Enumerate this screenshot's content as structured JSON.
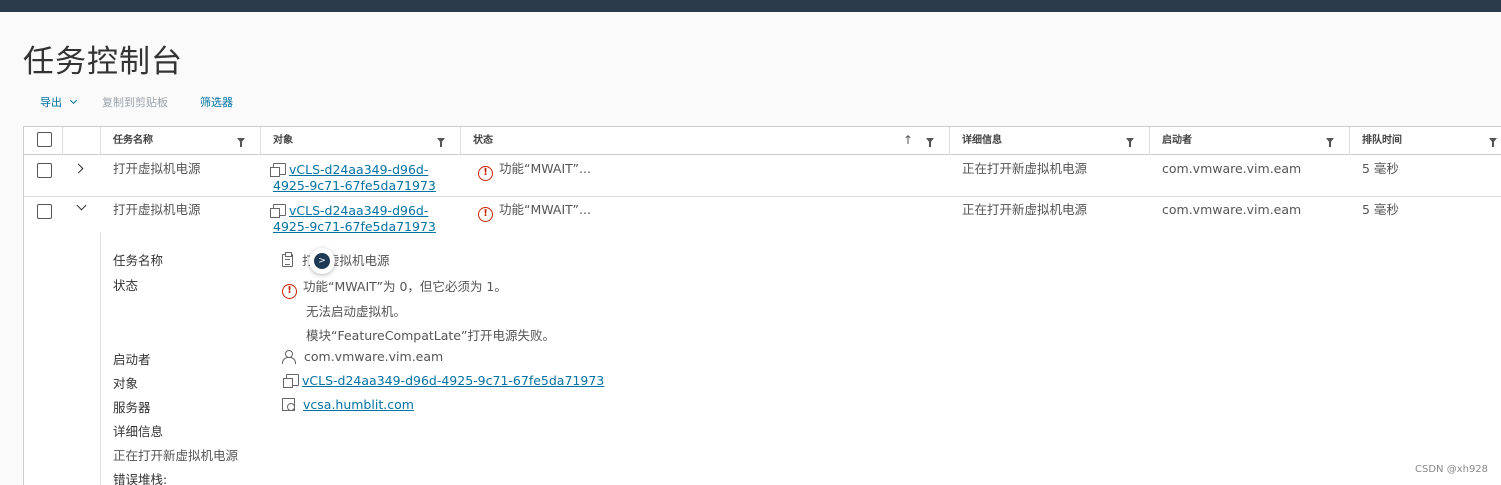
{
  "page": {
    "title": "任务控制台"
  },
  "toolbar": {
    "export_label": "导出",
    "copy_label": "复制到剪贴板",
    "filter_label": "筛选器"
  },
  "columns": {
    "task_name": "任务名称",
    "object": "对象",
    "status": "状态",
    "details": "详细信息",
    "initiator": "启动者",
    "queue_time": "排队时间"
  },
  "rows": [
    {
      "task_name": "打开虚拟机电源",
      "object_line1": "vCLS-d24aa349-d96d-",
      "object_line2": "4925-9c71-67fe5da71973",
      "status": "功能“MWAIT”...",
      "details": "正在打开新虚拟机电源",
      "initiator": "com.vmware.vim.eam",
      "queue_time": "5 毫秒"
    },
    {
      "task_name": "打开虚拟机电源",
      "object_line1": "vCLS-d24aa349-d96d-",
      "object_line2": "4925-9c71-67fe5da71973",
      "status": "功能“MWAIT”...",
      "details": "正在打开新虚拟机电源",
      "initiator": "com.vmware.vim.eam",
      "queue_time": "5 毫秒"
    }
  ],
  "detail": {
    "task_name_label": "任务名称",
    "task_name_value": "打开虚拟机电源",
    "status_label": "状态",
    "status_line1": "功能“MWAIT”为 0，但它必须为 1。",
    "status_line2": "无法启动虚拟机。",
    "status_line3": "模块“FeatureCompatLate”打开电源失败。",
    "initiator_label": "启动者",
    "initiator_value": "com.vmware.vim.eam",
    "object_label": "对象",
    "object_value": "vCLS-d24aa349-d96d-4925-9c71-67fe5da71973",
    "server_label": "服务器",
    "server_value": "vcsa.humblit.com",
    "details_label": "详细信息",
    "details_value": "正在打开新虚拟机电源",
    "error_stack_label": "错误堆栈:"
  },
  "watermark": "CSDN @xh928",
  "colors": {
    "link": "#0072a3",
    "error": "#c92100",
    "topbar": "#2b3a4a"
  },
  "icons": [
    "vm-icon",
    "error-icon",
    "clipboard-icon",
    "user-icon",
    "server-icon",
    "filter-icon",
    "sort-up-icon",
    "chevron-right-icon",
    "chevron-down-icon"
  ]
}
